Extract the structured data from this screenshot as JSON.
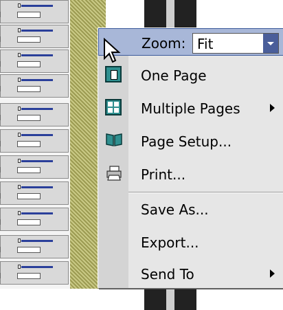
{
  "menu": {
    "zoom_label": "Zoom:",
    "zoom_value": "Fit",
    "items": [
      {
        "label": "One Page",
        "icon": "one-page-icon"
      },
      {
        "label": "Multiple Pages",
        "icon": "multiple-pages-icon",
        "submenu": true
      },
      {
        "label": "Page Setup...",
        "icon": "page-setup-book-icon"
      },
      {
        "label": "Print...",
        "icon": "printer-icon"
      },
      {
        "label": "Save As...",
        "icon": ""
      },
      {
        "label": "Export...",
        "icon": ""
      },
      {
        "label": "Send To",
        "icon": "",
        "submenu": true
      }
    ]
  },
  "colors": {
    "highlight": "#a8b7d8",
    "menu_bg": "#e6e6e6",
    "hatch": "#9c9b52"
  }
}
